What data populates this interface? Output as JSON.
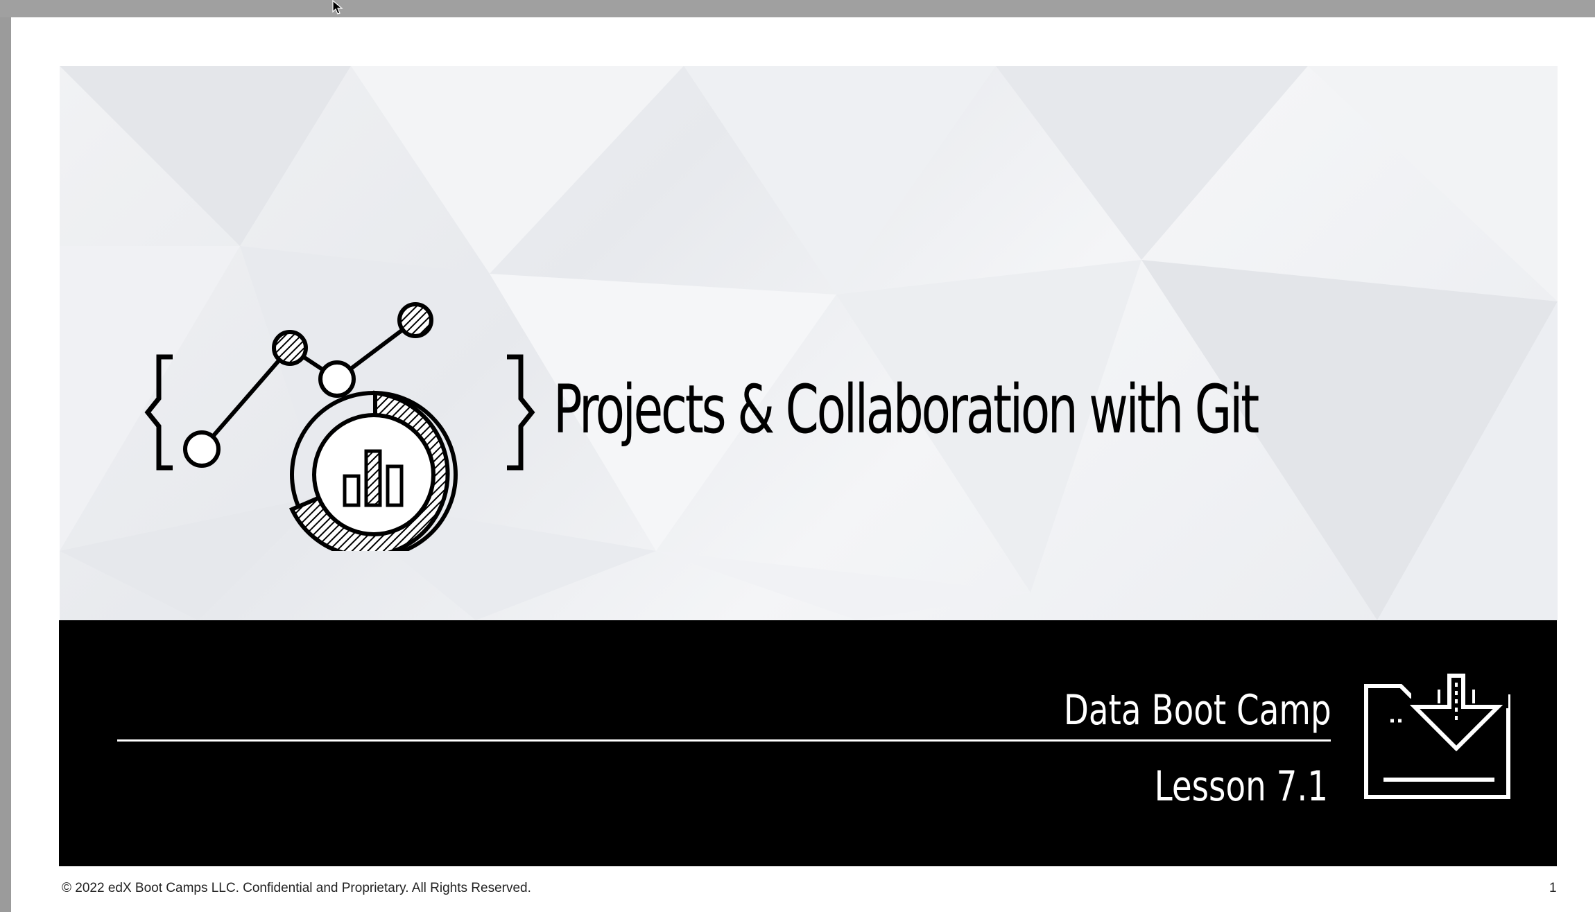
{
  "slide": {
    "title": "Projects & Collaboration with Git",
    "program": "Data Boot Camp",
    "lesson": "Lesson 7.1",
    "copyright": "© 2022 edX Boot Camps LLC. Confidential and Proprietary. All Rights Reserved.",
    "page_number": "1"
  },
  "icons": {
    "logo": "data-analytics-chart-icon",
    "folder": "folder-download-icon",
    "cursor": "mouse-pointer-icon"
  },
  "colors": {
    "band": "#000000",
    "hero_background": "#eceef1",
    "text_light": "#ffffff",
    "text_dark": "#000000"
  }
}
